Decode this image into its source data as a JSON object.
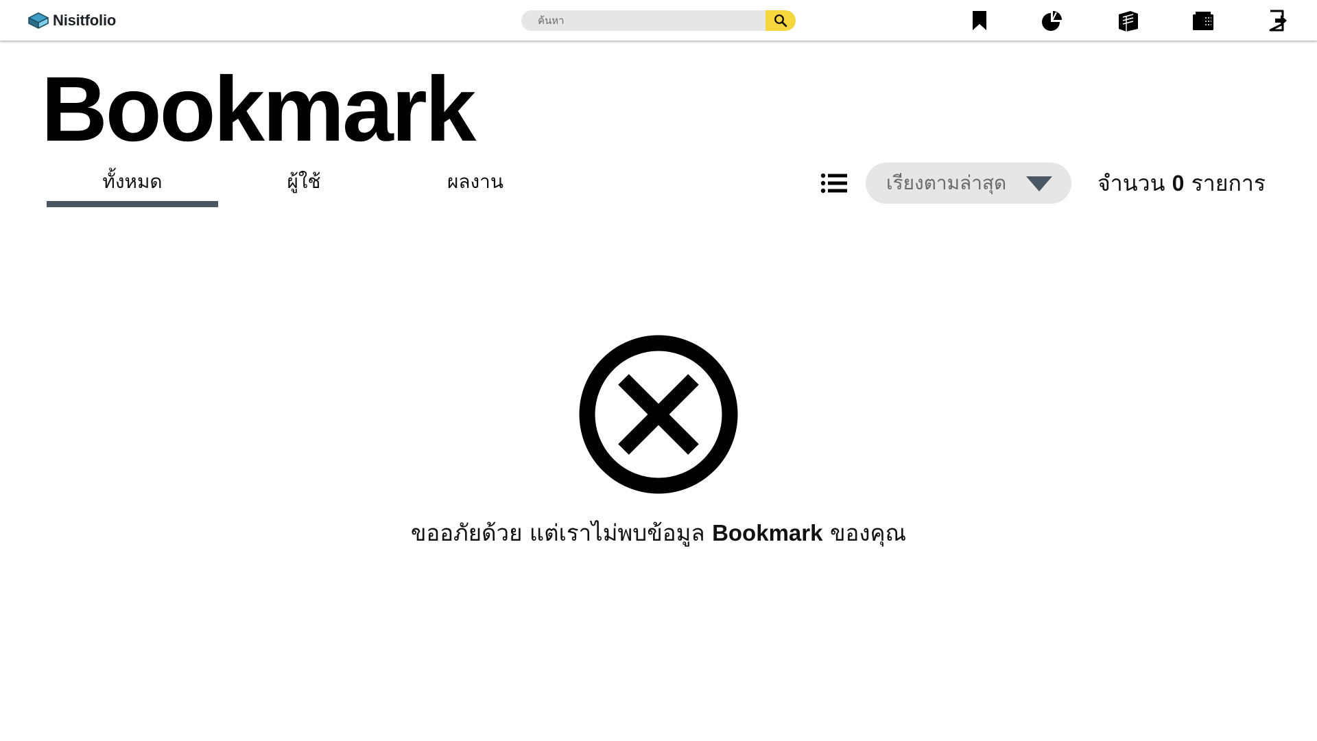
{
  "app": {
    "name": "Nisitfolio"
  },
  "search": {
    "placeholder": "ค้นหา"
  },
  "nav": {
    "icons": [
      "bookmark-icon",
      "pie-chart-icon",
      "portfolio-book-icon",
      "wallet-icon",
      "logout-icon"
    ]
  },
  "page": {
    "title": "Bookmark"
  },
  "tabs": [
    {
      "label": "ทั้งหมด",
      "active": true
    },
    {
      "label": "ผู้ใช้",
      "active": false
    },
    {
      "label": "ผลงาน",
      "active": false
    }
  ],
  "sort": {
    "selected": "เรียงตามล่าสุด"
  },
  "count": {
    "prefix": "จำนวน",
    "value": "0",
    "suffix": "รายการ"
  },
  "empty_state": {
    "icon": "circle-x-icon",
    "message_prefix": "ขออภัยด้วย แต่เราไม่พบข้อมูล",
    "message_highlight": "Bookmark",
    "message_suffix": "ของคุณ"
  },
  "colors": {
    "search_button": "#f5d63d",
    "tab_underline": "#4a5661",
    "sort_background": "#e6e6e6"
  }
}
